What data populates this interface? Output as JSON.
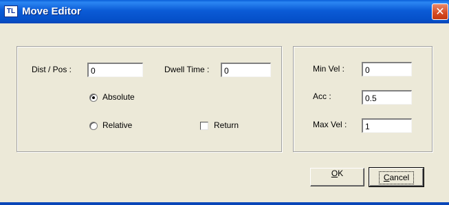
{
  "window": {
    "app_icon_text": "TL",
    "title": "Move Editor",
    "close_glyph": "✕"
  },
  "left_panel": {
    "dist_pos_label": "Dist / Pos :",
    "dist_pos_value": "0",
    "dwell_time_label": "Dwell Time :",
    "dwell_time_value": "0",
    "absolute_label": "Absolute",
    "absolute_selected": true,
    "relative_label": "Relative",
    "relative_selected": false,
    "return_label": "Return",
    "return_checked": false
  },
  "right_panel": {
    "min_vel_label": "Min Vel :",
    "min_vel_value": "0",
    "acc_label": "Acc :",
    "acc_value": "0.5",
    "max_vel_label": "Max Vel :",
    "max_vel_value": "1"
  },
  "buttons": {
    "ok_mnemonic": "O",
    "ok_rest": "K",
    "cancel_mnemonic": "C",
    "cancel_rest": "ancel"
  }
}
